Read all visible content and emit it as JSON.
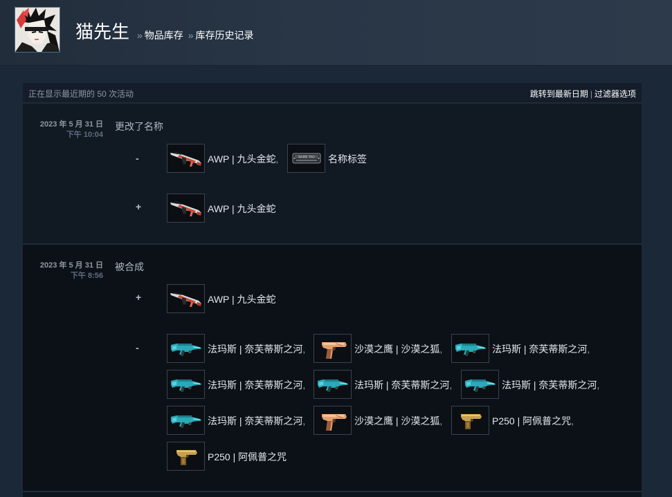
{
  "header": {
    "persona_name": "猫先生",
    "breadcrumb_sep": "»",
    "breadcrumbs": [
      "物品库存",
      "库存历史记录"
    ]
  },
  "topbar": {
    "count_text": "正在显示最近期的 50 次活动",
    "jump_link": "跳转到最新日期",
    "divider": "|",
    "filter_link": "过滤器选项"
  },
  "events": [
    {
      "date": "2023 年 5 月 31 日",
      "time": "下午 10:04",
      "description": "更改了名称",
      "groups": [
        {
          "sign": "-",
          "items": [
            {
              "name": "AWP | 九头金蛇",
              "comma": ",",
              "icon": "awp-hydra-icon"
            },
            {
              "name": "名称标签",
              "comma": "",
              "icon": "name-tag-icon"
            }
          ]
        },
        {
          "sign": "+",
          "items": [
            {
              "name": "AWP | 九头金蛇",
              "comma": "",
              "icon": "awp-hydra-icon"
            }
          ]
        }
      ]
    },
    {
      "date": "2023 年 5 月 31 日",
      "time": "下午 8:56",
      "description": "被合成",
      "groups": [
        {
          "sign": "+",
          "items": [
            {
              "name": "AWP | 九头金蛇",
              "comma": "",
              "icon": "awp-hydra-icon"
            }
          ]
        },
        {
          "sign": "-",
          "items": [
            {
              "name": "法玛斯 | 奈芙蒂斯之河",
              "comma": ",",
              "icon": "famas-icon"
            },
            {
              "name": "沙漠之鹰 | 沙漠之狐",
              "comma": ",",
              "icon": "deagle-icon"
            },
            {
              "name": "法玛斯 | 奈芙蒂斯之河",
              "comma": ",",
              "icon": "famas-icon"
            },
            {
              "name": "法玛斯 | 奈芙蒂斯之河",
              "comma": ",",
              "icon": "famas-icon"
            },
            {
              "name": "法玛斯 | 奈芙蒂斯之河",
              "comma": ",",
              "icon": "famas-icon"
            },
            {
              "name": "法玛斯 | 奈芙蒂斯之河",
              "comma": ",",
              "icon": "famas-icon"
            },
            {
              "name": "法玛斯 | 奈芙蒂斯之河",
              "comma": ",",
              "icon": "famas-icon"
            },
            {
              "name": "沙漠之鹰 | 沙漠之狐",
              "comma": ",",
              "icon": "deagle-icon"
            },
            {
              "name": "P250 | 阿佩普之咒",
              "comma": ",",
              "icon": "p250-icon"
            },
            {
              "name": "P250 | 阿佩普之咒",
              "comma": "",
              "icon": "p250-icon"
            }
          ]
        }
      ]
    }
  ],
  "colors": {
    "background": "#1b2838",
    "panel": "#0e141b",
    "link": "#ffffff",
    "muted": "#8f98a0"
  }
}
